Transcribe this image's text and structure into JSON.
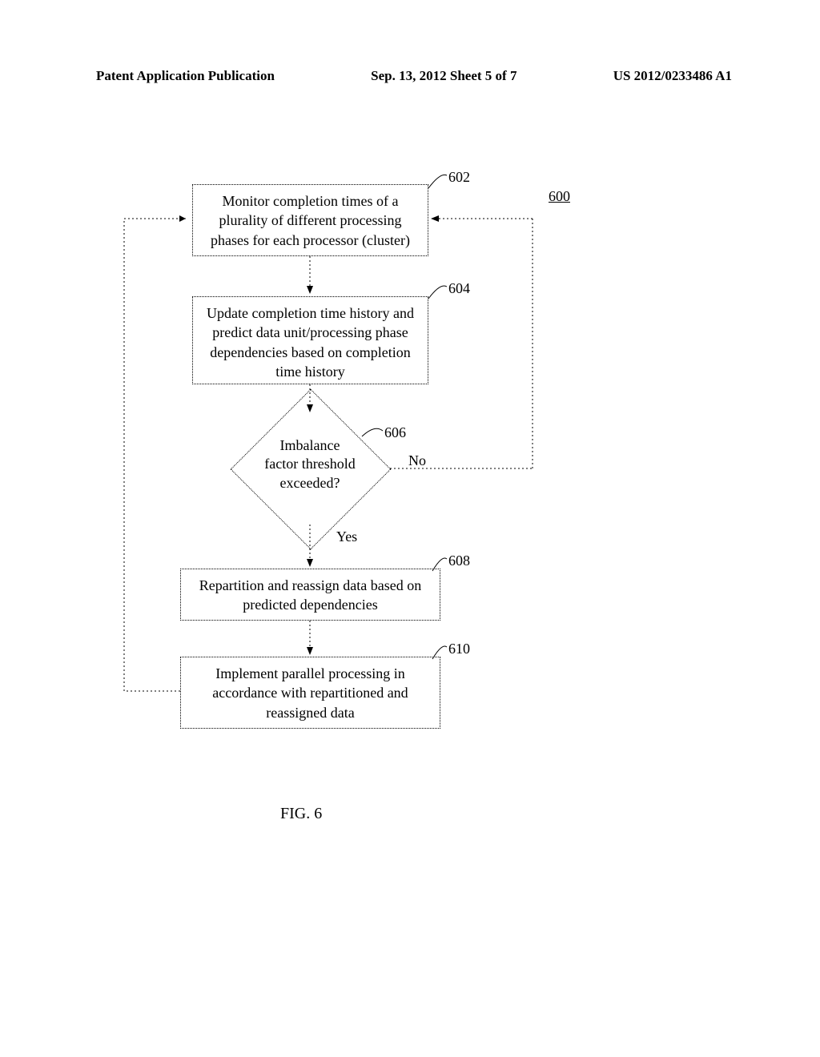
{
  "header": {
    "left": "Patent Application Publication",
    "center": "Sep. 13, 2012  Sheet 5 of 7",
    "right": "US 2012/0233486 A1"
  },
  "refs": {
    "r600": "600",
    "r602": "602",
    "r604": "604",
    "r606": "606",
    "r608": "608",
    "r610": "610"
  },
  "boxes": {
    "b602": "Monitor completion times of a plurality of different processing phases for each processor (cluster)",
    "b604": "Update completion time history and predict data unit/processing phase dependencies based on completion time history",
    "d606_l1": "Imbalance",
    "d606_l2": "factor threshold",
    "d606_l3": "exceeded?",
    "b608": "Repartition and reassign data based on predicted dependencies",
    "b610": "Implement parallel processing in accordance with repartitioned and reassigned data"
  },
  "labels": {
    "no": "No",
    "yes": "Yes"
  },
  "caption": "FIG. 6",
  "chart_data": {
    "type": "flowchart",
    "title": "FIG. 6",
    "figure_id": "600",
    "nodes": [
      {
        "id": "602",
        "type": "process",
        "text": "Monitor completion times of a plurality of different processing phases for each processor (cluster)"
      },
      {
        "id": "604",
        "type": "process",
        "text": "Update completion time history and predict data unit/processing phase dependencies based on completion time history"
      },
      {
        "id": "606",
        "type": "decision",
        "text": "Imbalance factor threshold exceeded?"
      },
      {
        "id": "608",
        "type": "process",
        "text": "Repartition and reassign data based on predicted dependencies"
      },
      {
        "id": "610",
        "type": "process",
        "text": "Implement parallel processing in accordance with repartitioned and reassigned data"
      }
    ],
    "edges": [
      {
        "from": "external-left",
        "to": "602",
        "style": "dotted"
      },
      {
        "from": "602",
        "to": "604",
        "style": "dotted"
      },
      {
        "from": "604",
        "to": "606",
        "style": "dotted"
      },
      {
        "from": "606",
        "to": "602",
        "label": "No",
        "style": "dotted",
        "path": "right-up"
      },
      {
        "from": "606",
        "to": "608",
        "label": "Yes",
        "style": "dotted"
      },
      {
        "from": "608",
        "to": "610",
        "style": "dotted"
      },
      {
        "from": "610",
        "to": "602",
        "style": "dotted",
        "path": "left-up"
      }
    ]
  }
}
